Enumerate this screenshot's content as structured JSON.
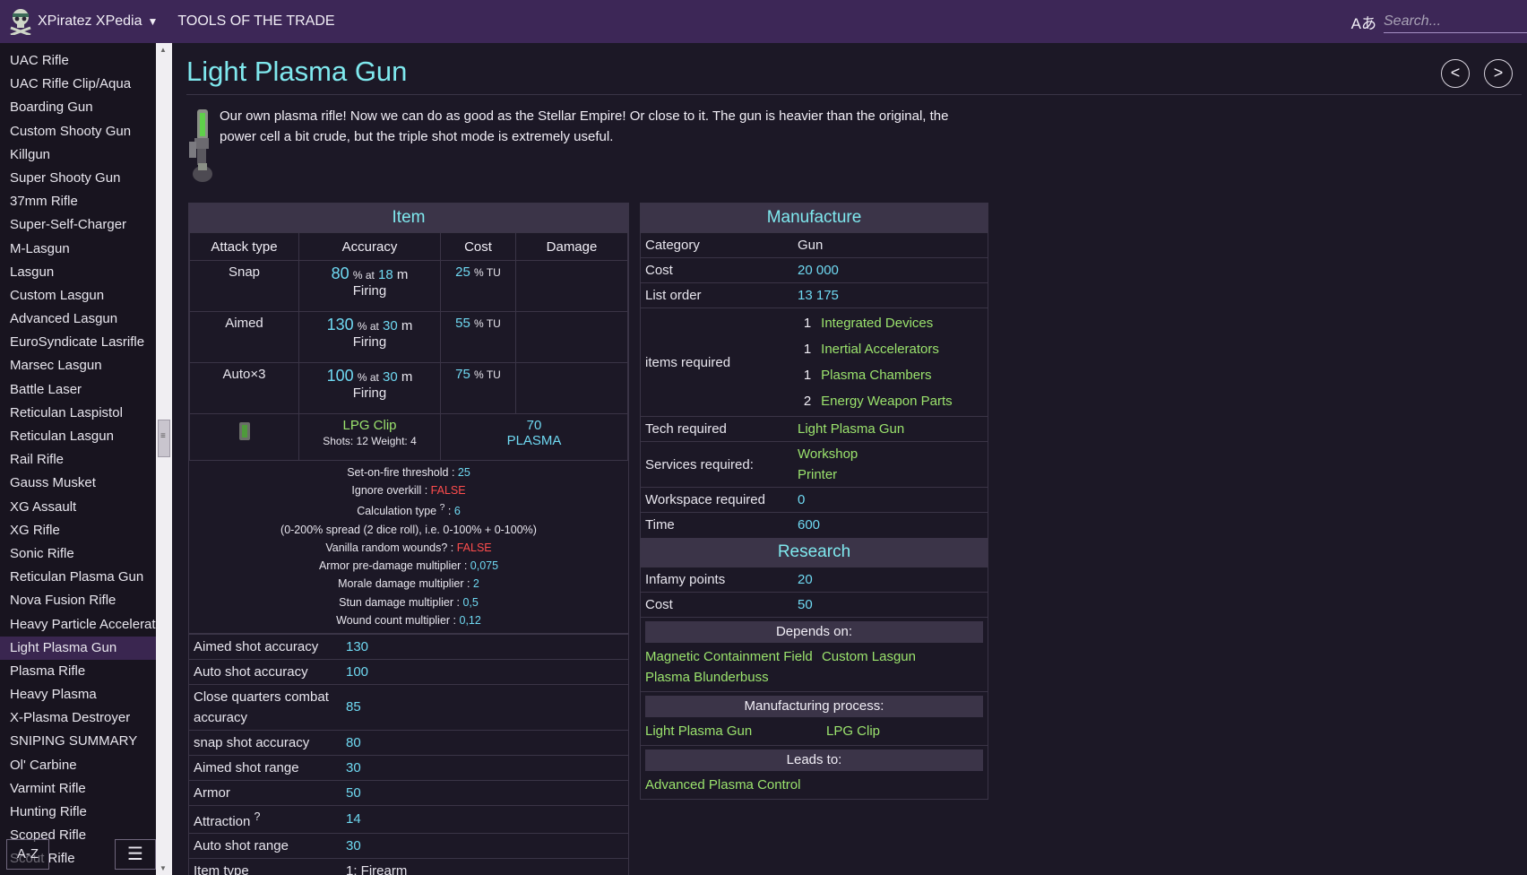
{
  "app": {
    "title": "XPiratez XPedia",
    "section": "TOOLS OF THE TRADE",
    "search_placeholder": "Search...",
    "lang_icon_text": "Aあ",
    "icons": {
      "logo": "skull-logo-icon",
      "lang": "language-icon",
      "menu": "hamburger-menu-icon"
    }
  },
  "sidebar": {
    "items": [
      "UAC Rifle",
      "UAC Rifle Clip/Aqua",
      "Boarding Gun",
      "Custom Shooty Gun",
      "Killgun",
      "Super Shooty Gun",
      "37mm Rifle",
      "Super-Self-Charger",
      "M-Lasgun",
      "Lasgun",
      "Custom Lasgun",
      "Advanced Lasgun",
      "EuroSyndicate Lasrifle",
      "Marsec Lasgun",
      "Battle Laser",
      "Reticulan Laspistol",
      "Reticulan Lasgun",
      "Rail Rifle",
      "Gauss Musket",
      "XG Assault",
      "XG Rifle",
      "Sonic Rifle",
      "Reticulan Plasma Gun",
      "Nova Fusion Rifle",
      "Heavy Particle Accelerator",
      "Light Plasma Gun",
      "Plasma Rifle",
      "Heavy Plasma",
      "X-Plasma Destroyer",
      "SNIPING SUMMARY",
      "Ol' Carbine",
      "Varmint Rifle",
      "Hunting Rifle",
      "Scoped Rifle",
      "Scout Rifle"
    ],
    "active_index": 25,
    "az_label": "A-Z",
    "menu_label": "☰"
  },
  "page": {
    "title": "Light Plasma Gun",
    "prev_label": "<",
    "next_label": ">",
    "description": "Our own plasma rifle! Now we can do as good as the Stellar Empire! Or close to it. The gun is heavier than the original, the power cell a bit crude, but the triple shot mode is extremely useful."
  },
  "item": {
    "heading": "Item",
    "columns": [
      "Attack type",
      "Accuracy",
      "Cost",
      "Damage"
    ],
    "attacks": [
      {
        "type": "Snap",
        "accuracy": "80",
        "range": "18",
        "mode": "Firing",
        "cost": "25"
      },
      {
        "type": "Aimed",
        "accuracy": "130",
        "range": "30",
        "mode": "Firing",
        "cost": "55"
      },
      {
        "type": "Auto×3",
        "accuracy": "100",
        "range": "30",
        "mode": "Firing",
        "cost": "75"
      }
    ],
    "acc_suffix": "% at",
    "range_unit": "m",
    "cost_unit": "% TU",
    "ammo": {
      "name": "LPG Clip",
      "stats": "Shots: 12 Weight: 4",
      "damage": "70",
      "damage_type": "PLASMA"
    },
    "properties": {
      "set_on_fire_label": "Set-on-fire threshold",
      "set_on_fire": "25",
      "ignore_overkill_label": "Ignore overkill",
      "ignore_overkill": "FALSE",
      "calc_type_label": "Calculation type",
      "calc_type_sup": "?",
      "calc_type": "6",
      "spread_note": "(0-200% spread (2 dice roll), i.e. 0-100% + 0-100%)",
      "vanilla_wounds_label": "Vanilla random wounds?",
      "vanilla_wounds": "FALSE",
      "armor_mult_label": "Armor pre-damage multiplier",
      "armor_mult": "0,075",
      "morale_mult_label": "Morale damage multiplier",
      "morale_mult": "2",
      "stun_mult_label": "Stun damage multiplier",
      "stun_mult": "0,5",
      "wound_mult_label": "Wound count multiplier",
      "wound_mult": "0,12"
    },
    "stats": [
      {
        "label": "Aimed shot accuracy",
        "value": "130"
      },
      {
        "label": "Auto shot accuracy",
        "value": "100"
      },
      {
        "label": "Close quarters combat accuracy",
        "value": "85"
      },
      {
        "label": "snap shot accuracy",
        "value": "80"
      },
      {
        "label": "Aimed shot range",
        "value": "30"
      },
      {
        "label": "Armor",
        "value": "50"
      },
      {
        "label": "Attraction",
        "sup": "?",
        "value": "14"
      },
      {
        "label": "Auto shot range",
        "value": "30"
      },
      {
        "label": "Item type",
        "value": "1: Firearm"
      }
    ]
  },
  "manufacture": {
    "heading": "Manufacture",
    "category_label": "Category",
    "category": "Gun",
    "cost_label": "Cost",
    "cost": "20 000",
    "list_order_label": "List order",
    "list_order": "13 175",
    "items_required_label": "items required",
    "items_required": [
      {
        "qty": "1",
        "name": "Integrated Devices"
      },
      {
        "qty": "1",
        "name": "Inertial Accelerators"
      },
      {
        "qty": "1",
        "name": "Plasma Chambers"
      },
      {
        "qty": "2",
        "name": "Energy Weapon Parts"
      }
    ],
    "tech_required_label": "Tech required",
    "tech_required": "Light Plasma Gun",
    "services_label": "Services required:",
    "services": [
      "Workshop",
      "Printer"
    ],
    "workspace_label": "Workspace required",
    "workspace": "0",
    "time_label": "Time",
    "time": "600"
  },
  "research": {
    "heading": "Research",
    "infamy_label": "Infamy points",
    "infamy": "20",
    "cost_label": "Cost",
    "cost": "50",
    "depends_heading": "Depends on:",
    "depends": [
      "Magnetic Containment Field",
      "Custom Lasgun",
      "Plasma Blunderbuss"
    ],
    "mfg_process_heading": "Manufacturing process:",
    "mfg_process": [
      "Light Plasma Gun",
      "LPG Clip"
    ],
    "leads_heading": "Leads to:",
    "leads": [
      "Advanced Plasma Control"
    ]
  },
  "colors": {
    "topbar": "#3d2757",
    "background": "#1c1826",
    "sidebar": "#18141f",
    "title_cyan": "#7fe8ee",
    "value_cyan": "#6fd9f2",
    "link_green": "#9be36d",
    "false_red": "#ff4d4d"
  }
}
